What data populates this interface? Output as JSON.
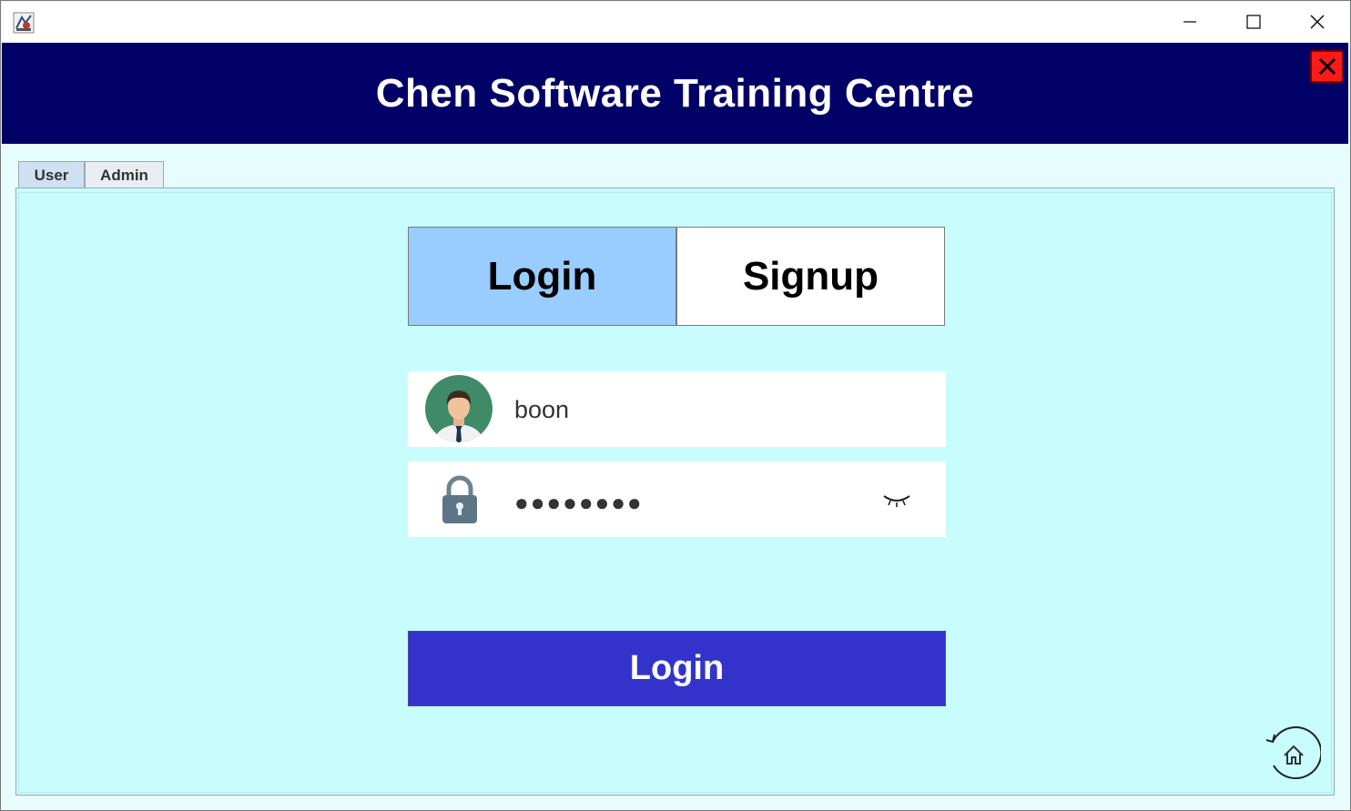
{
  "window": {
    "app_icon": "java-app-icon",
    "controls": {
      "minimize": "minimize-icon",
      "maximize": "maximize-icon",
      "close": "close-icon"
    }
  },
  "header": {
    "title": "Chen Software Training Centre",
    "close_icon": "x-close-icon",
    "colors": {
      "background": "#000066",
      "close_bg": "#ff1a1a"
    }
  },
  "tabs": [
    {
      "label": "User",
      "selected": true
    },
    {
      "label": "Admin",
      "selected": false
    }
  ],
  "mode_toggle": {
    "login_label": "Login",
    "signup_label": "Signup",
    "active": "Login",
    "colors": {
      "active": "#99ccff",
      "inactive": "#ffffff"
    }
  },
  "form": {
    "username": {
      "value": "boon",
      "icon": "user-avatar-icon"
    },
    "password": {
      "masked_value": "●●●●●●●●",
      "icon": "lock-icon",
      "toggle_icon": "eye-closed-icon"
    },
    "submit_label": "Login",
    "colors": {
      "submit": "#3333cc",
      "panel": "#c9fdfd"
    }
  },
  "footer": {
    "home_icon": "home-reset-icon"
  }
}
